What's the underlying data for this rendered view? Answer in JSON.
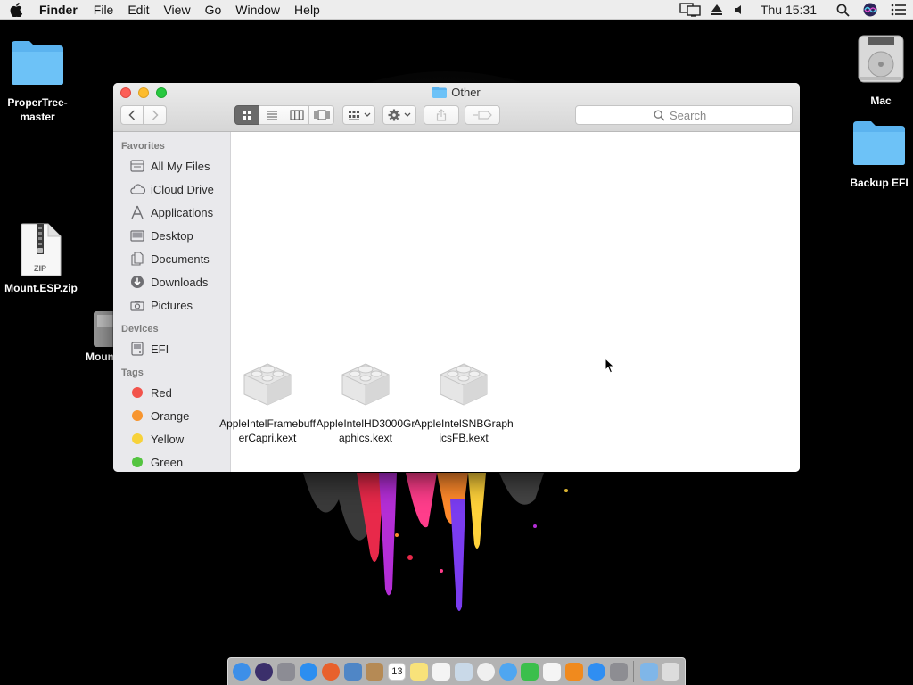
{
  "menubar": {
    "app_name": "Finder",
    "menus": [
      "File",
      "Edit",
      "View",
      "Go",
      "Window",
      "Help"
    ],
    "clock": "Thu 15:31"
  },
  "desktop": {
    "icons": {
      "propertree": "ProperTree-\nmaster",
      "mount_zip": "Mount.ESP.zip",
      "mount_partial": "Moun",
      "mac": "Mac",
      "backup_efi": "Backup EFI"
    },
    "zip_badge": "ZIP"
  },
  "window": {
    "title": "Other",
    "search_placeholder": "Search"
  },
  "sidebar": {
    "favorites_header": "Favorites",
    "favorites": [
      {
        "label": "All My Files",
        "icon": "all-files-icon"
      },
      {
        "label": "iCloud Drive",
        "icon": "cloud-icon"
      },
      {
        "label": "Applications",
        "icon": "applications-icon"
      },
      {
        "label": "Desktop",
        "icon": "desktop-icon"
      },
      {
        "label": "Documents",
        "icon": "documents-icon"
      },
      {
        "label": "Downloads",
        "icon": "downloads-icon"
      },
      {
        "label": "Pictures",
        "icon": "camera-icon"
      }
    ],
    "devices_header": "Devices",
    "devices": [
      {
        "label": "EFI",
        "icon": "disk-icon"
      }
    ],
    "tags_header": "Tags",
    "tags": [
      {
        "label": "Red",
        "color": "#f2534b"
      },
      {
        "label": "Orange",
        "color": "#f7952f"
      },
      {
        "label": "Yellow",
        "color": "#f7d23a"
      },
      {
        "label": "Green",
        "color": "#54c440"
      }
    ]
  },
  "files": [
    {
      "name": "AppleIntelFramebufferCapri.kext"
    },
    {
      "name": "AppleIntelHD3000Graphics.kext"
    },
    {
      "name": "AppleIntelSNBGraphicsFB.kext"
    }
  ],
  "dock": {
    "calendar_day": "13",
    "apps": [
      {
        "icon": "finder-icon",
        "color": "#3d8fe8"
      },
      {
        "icon": "siri-icon",
        "color": "#3b2f6b"
      },
      {
        "icon": "launchpad-icon",
        "color": "#8c8c94"
      },
      {
        "icon": "safari-icon",
        "color": "#2b8ef0"
      },
      {
        "icon": "firefox-icon",
        "color": "#e8612c"
      },
      {
        "icon": "preview-icon",
        "color": "#4f86c6"
      },
      {
        "icon": "contacts-icon",
        "color": "#b58a55"
      },
      {
        "icon": "calendar-icon",
        "color": "#ffffff"
      },
      {
        "icon": "notes-icon",
        "color": "#f8e27a"
      },
      {
        "icon": "reminders-icon",
        "color": "#f4f4f4"
      },
      {
        "icon": "photo-booth-icon",
        "color": "#c9d9e8"
      },
      {
        "icon": "photos-icon",
        "color": "#f0f0f0"
      },
      {
        "icon": "messages-icon",
        "color": "#4fa6f0"
      },
      {
        "icon": "facetime-icon",
        "color": "#3bbf4c"
      },
      {
        "icon": "itunes-icon",
        "color": "#f5f5f5"
      },
      {
        "icon": "ibooks-icon",
        "color": "#f08a1e"
      },
      {
        "icon": "app-store-icon",
        "color": "#2f8ef2"
      },
      {
        "icon": "system-preferences-icon",
        "color": "#8d8d92"
      }
    ],
    "right_items": [
      {
        "icon": "downloads-stack-icon",
        "color": "#7fb6e8"
      },
      {
        "icon": "trash-icon",
        "color": "#dcdcdc"
      }
    ]
  }
}
